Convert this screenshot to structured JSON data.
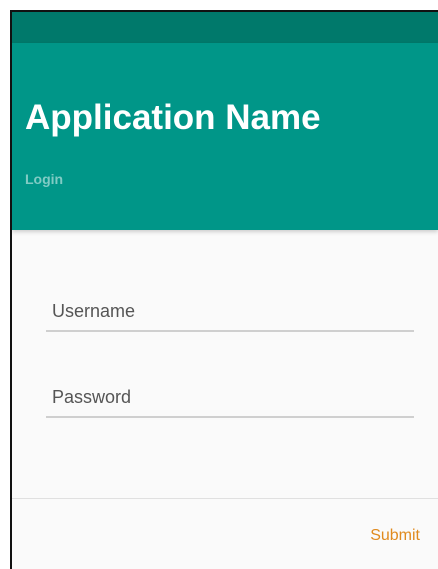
{
  "header": {
    "title": "Application Name",
    "subtitle": "Login"
  },
  "form": {
    "username": {
      "placeholder": "Username",
      "value": ""
    },
    "password": {
      "placeholder": "Password",
      "value": ""
    }
  },
  "actions": {
    "submit_label": "Submit"
  },
  "colors": {
    "status_bar": "#00796b",
    "header": "#009688",
    "subtitle": "#80cbc4",
    "accent": "#e08a1e",
    "background": "#fafafa"
  }
}
